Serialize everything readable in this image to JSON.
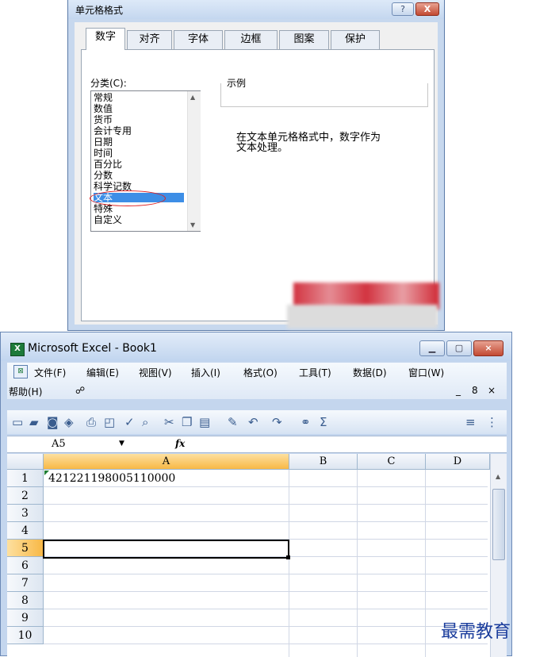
{
  "format_dialog": {
    "title": "单元格格式",
    "help_label": "?",
    "close_label": "X",
    "tabs": [
      {
        "label": "数字",
        "active": true
      },
      {
        "label": "对齐",
        "active": false
      },
      {
        "label": "字体",
        "active": false
      },
      {
        "label": "边框",
        "active": false
      },
      {
        "label": "图案",
        "active": false
      },
      {
        "label": "保护",
        "active": false
      }
    ],
    "category_label": "分类(C):",
    "categories": [
      "常规",
      "数值",
      "货币",
      "会计专用",
      "日期",
      "时间",
      "百分比",
      "分数",
      "科学记数",
      "文本",
      "特殊",
      "自定义"
    ],
    "selected_category": "文本",
    "sample_label": "示例",
    "description_line1": "在文本单元格格式中，数字作为",
    "description_line2": "文本处理。"
  },
  "excel": {
    "app_title": "Microsoft Excel - Book1",
    "menus_row1": [
      "文件(F)",
      "编辑(E)",
      "视图(V)",
      "插入(I)",
      "格式(O)",
      "工具(T)",
      "数据(D)",
      "窗口(W)"
    ],
    "menus_row2": [
      "帮助(H)"
    ],
    "mdi_controls": [
      "_",
      "8",
      "×"
    ],
    "name_box": "A5",
    "fx_label": "fx",
    "columns": [
      "A",
      "B",
      "C",
      "D"
    ],
    "active_column": "A",
    "rows": [
      "1",
      "2",
      "3",
      "4",
      "5",
      "6",
      "7",
      "8",
      "9",
      "10"
    ],
    "active_row": "5",
    "cell_a1": "421221198005110000"
  },
  "watermark": "最需教育",
  "colors": {
    "selected_item": "#3d8ee6",
    "annotation_oval": "#e02020",
    "active_header": "#f8b846",
    "watermark": "#1a3c9c"
  }
}
